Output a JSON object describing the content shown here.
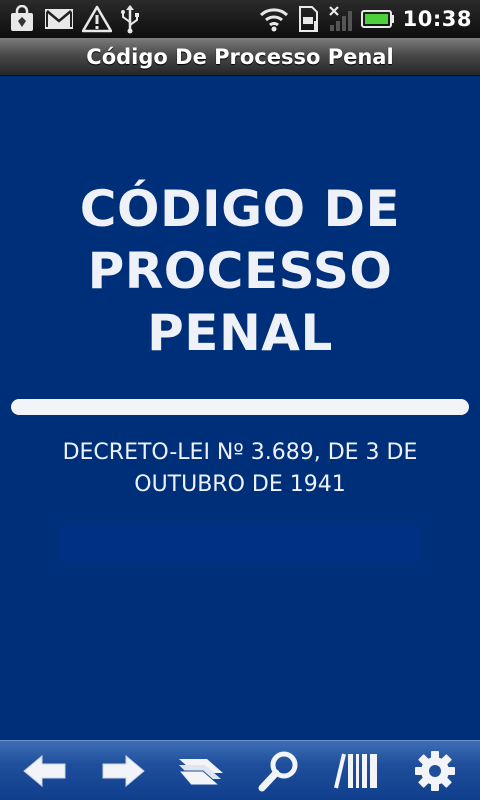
{
  "status_bar": {
    "time": "10:38",
    "notification_icons": [
      "shopping-bag-icon",
      "gmail-icon",
      "warning-icon",
      "usb-icon"
    ],
    "system_icons": [
      "wifi-icon",
      "sd-card-icon",
      "signal-icon",
      "battery-icon"
    ],
    "battery_color": "#4cd13a"
  },
  "title_bar": {
    "title": "Código De Processo Penal"
  },
  "main": {
    "heading_line1": "CÓDIGO DE",
    "heading_line2": "PROCESSO PENAL",
    "subheading_line1": "DECRETO-LEI Nº 3.689, DE 3 DE",
    "subheading_line2": "OUTUBRO DE 1941"
  },
  "toolbar": {
    "buttons": [
      "back-arrow-icon",
      "forward-arrow-icon",
      "bookmarks-icon",
      "search-icon",
      "library-icon",
      "settings-gear-icon"
    ]
  },
  "colors": {
    "background": "#002f7a",
    "toolbar": "#1f4f9c",
    "text": "#eef1f8"
  }
}
